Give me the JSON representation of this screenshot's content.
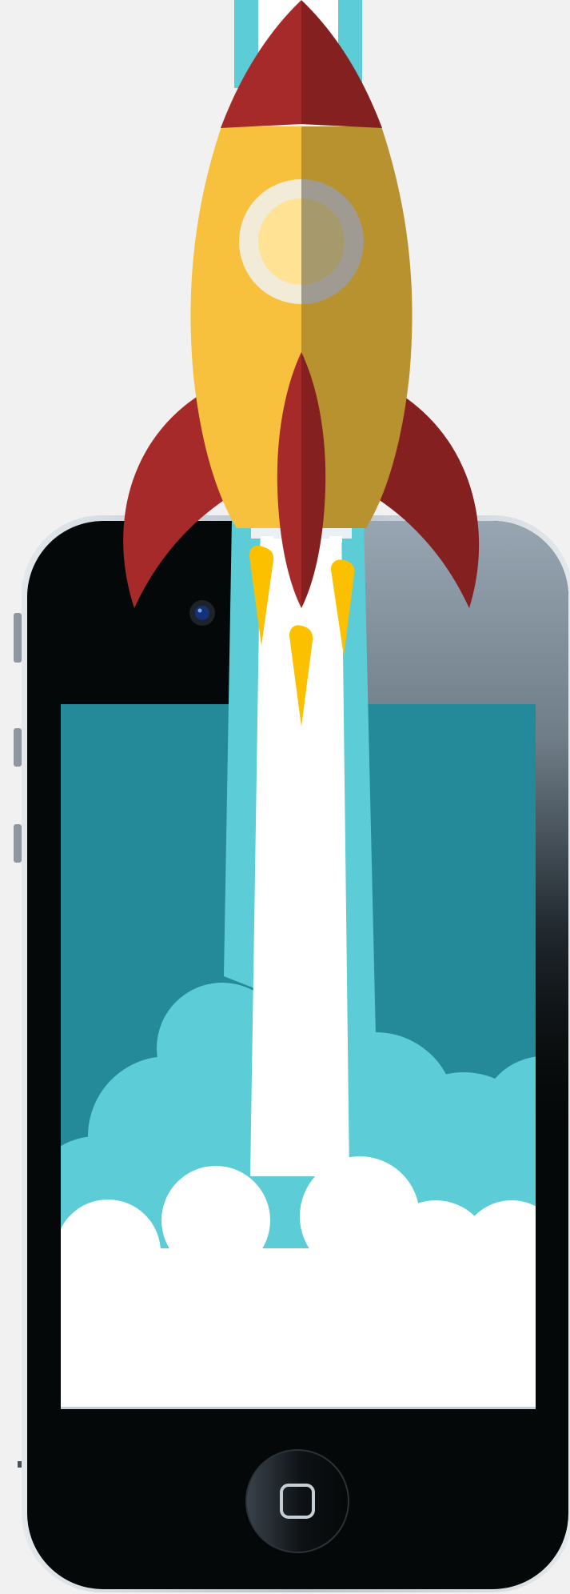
{
  "scene": {
    "background_color": "#f1f1f1",
    "subject": [
      "rocket",
      "smartphone",
      "launch-smoke"
    ]
  },
  "rocket": {
    "body_left": "#f8c13d",
    "body_right": "#b8922e",
    "nose_left": "#a72a2a",
    "nose_right": "#842020",
    "fin_left": "#a72a2a",
    "fin_right": "#842020",
    "window_ring_left": "#f1ebd7",
    "window_ring_right": "#9f9b93",
    "window_glass_left": "#ffe294",
    "window_glass_right": "#a69a6c",
    "flame_color": "#fbc000"
  },
  "exhaust": {
    "outer_color": "#5ccdd6",
    "inner_color": "#ffffff"
  },
  "phone": {
    "frame_color": "#050808",
    "bezel_edge": "#c7cfd6",
    "screen_color": "#248a99",
    "home_button_icon": "square-icon",
    "camera_icon": "camera-icon",
    "side_buttons_count": 3
  },
  "clouds": {
    "back_color": "#5ccdd6",
    "front_color": "#ffffff"
  }
}
